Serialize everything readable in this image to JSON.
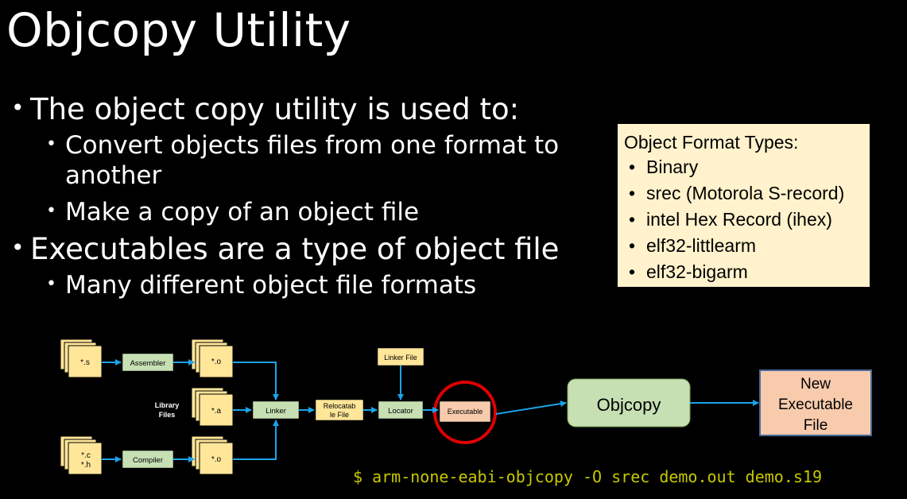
{
  "slide": {
    "title": "Objcopy Utility",
    "bullets": {
      "b1": "The object copy utility is used to:",
      "b1_sub1": "Convert objects files from one format to another",
      "b1_sub2": "Make a copy of an object file",
      "b2": "Executables are a type of object file",
      "b2_sub1": "Many different object file formats"
    }
  },
  "format_box": {
    "header": "Object Format Types:",
    "items": [
      "Binary",
      "srec (Motorola S-record)",
      "intel Hex Record (ihex)",
      "elf32-littlearm",
      "elf32-bigarm"
    ]
  },
  "diagram": {
    "file_s": "*.s",
    "file_o1": "*.o",
    "file_a": "*.a",
    "file_c": "*.c",
    "file_h": "*.h",
    "file_o2": "*.o",
    "library_files_1": "Library",
    "library_files_2": "Files",
    "assembler": "Assembler",
    "compiler": "Compiler",
    "linker": "Linker",
    "relocatable_1": "Relocatab",
    "relocatable_2": "le File",
    "locator": "Locator",
    "linker_file": "Linker File",
    "executable": "Executable",
    "objcopy": "Objcopy",
    "new_exec_1": "New",
    "new_exec_2": "Executable",
    "new_exec_3": "File"
  },
  "command": "$ arm-none-eabi-objcopy -O srec demo.out demo.s19",
  "colors": {
    "green_box": "#c6e0b4",
    "file_yellow": "#ffe699",
    "exec_orange": "#f8cbad",
    "arrow_blue": "#1aa3e8",
    "highlight_red": "#e00000",
    "command_yellow": "#c8c800"
  }
}
